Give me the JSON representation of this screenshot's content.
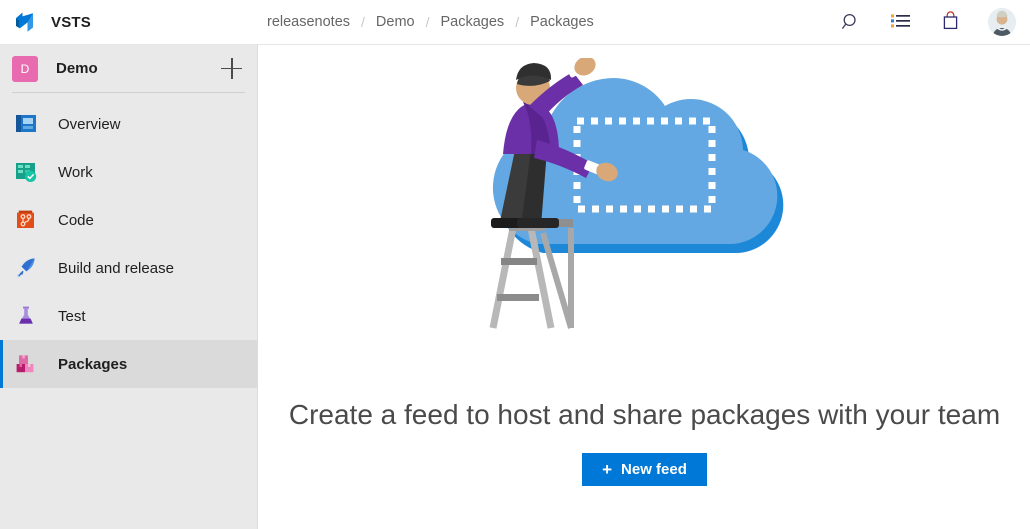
{
  "header": {
    "brand_name": "VSTS",
    "brand_logo_icon": "vsts-logo-icon",
    "breadcrumb": [
      "releasenotes",
      "Demo",
      "Packages",
      "Packages"
    ],
    "breadcrumb_separator": "/",
    "actions": [
      {
        "name": "search-icon",
        "label": "Search"
      },
      {
        "name": "work-items-icon",
        "label": "Work items"
      },
      {
        "name": "marketplace-bag-icon",
        "label": "Marketplace"
      },
      {
        "name": "user-avatar",
        "label": "User profile"
      }
    ]
  },
  "sidebar": {
    "project": {
      "badge_letter": "D",
      "name": "Demo",
      "badge_color": "#e86bb0",
      "add_label": "+"
    },
    "items": [
      {
        "label": "Overview",
        "icon": "overview-chart-icon",
        "selected": false
      },
      {
        "label": "Work",
        "icon": "work-board-icon",
        "selected": false
      },
      {
        "label": "Code",
        "icon": "code-repo-icon",
        "selected": false
      },
      {
        "label": "Build and release",
        "icon": "rocket-icon",
        "selected": false
      },
      {
        "label": "Test",
        "icon": "test-flask-icon",
        "selected": false
      },
      {
        "label": "Packages",
        "icon": "packages-boxes-icon",
        "selected": true
      }
    ],
    "selection_accent_color": "#0078d4"
  },
  "main": {
    "illustration_name": "person-drawing-on-cloud-illustration",
    "headline": "Create a feed to host and share packages with your team",
    "new_feed_button": {
      "label": "New feed",
      "plus": "+",
      "color": "#0078d7"
    }
  }
}
